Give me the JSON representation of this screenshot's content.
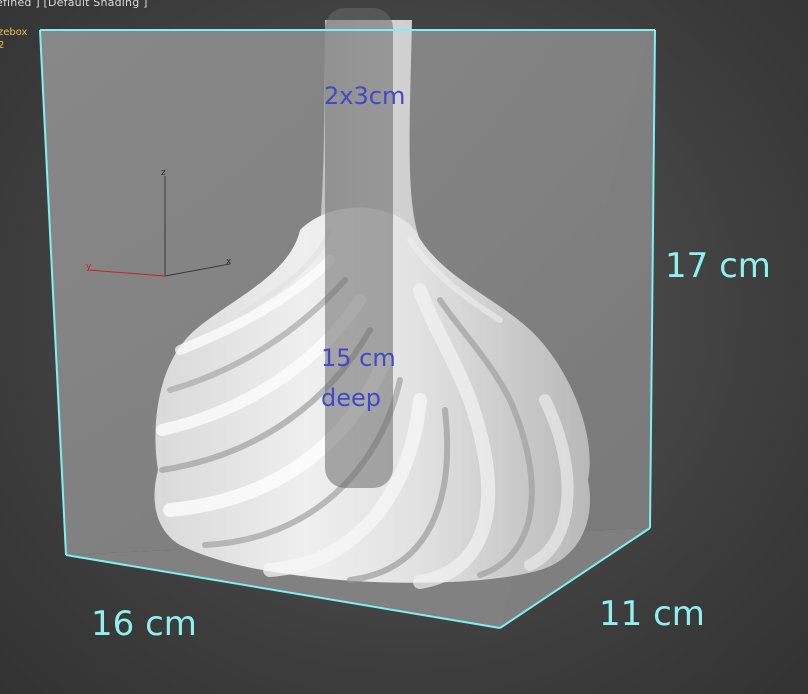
{
  "viewport": {
    "label": "efined ] [Default Shading ]",
    "stats": [
      "zebox",
      "2"
    ]
  },
  "dimensions": {
    "height": "17 cm",
    "width": "16 cm",
    "depth": "11 cm"
  },
  "annotations": {
    "opening": "2x3cm",
    "cavity_line1": "15 cm",
    "cavity_line2": "deep"
  },
  "gizmo": {
    "z": "z",
    "x": "x",
    "y": "y"
  },
  "colors": {
    "bounding_box": "#7ff0f0",
    "dimension_text": "#8ff0ee",
    "annotation_text": "#4149c6",
    "stats_text": "#e8c44a",
    "y_axis": "#c02424"
  }
}
